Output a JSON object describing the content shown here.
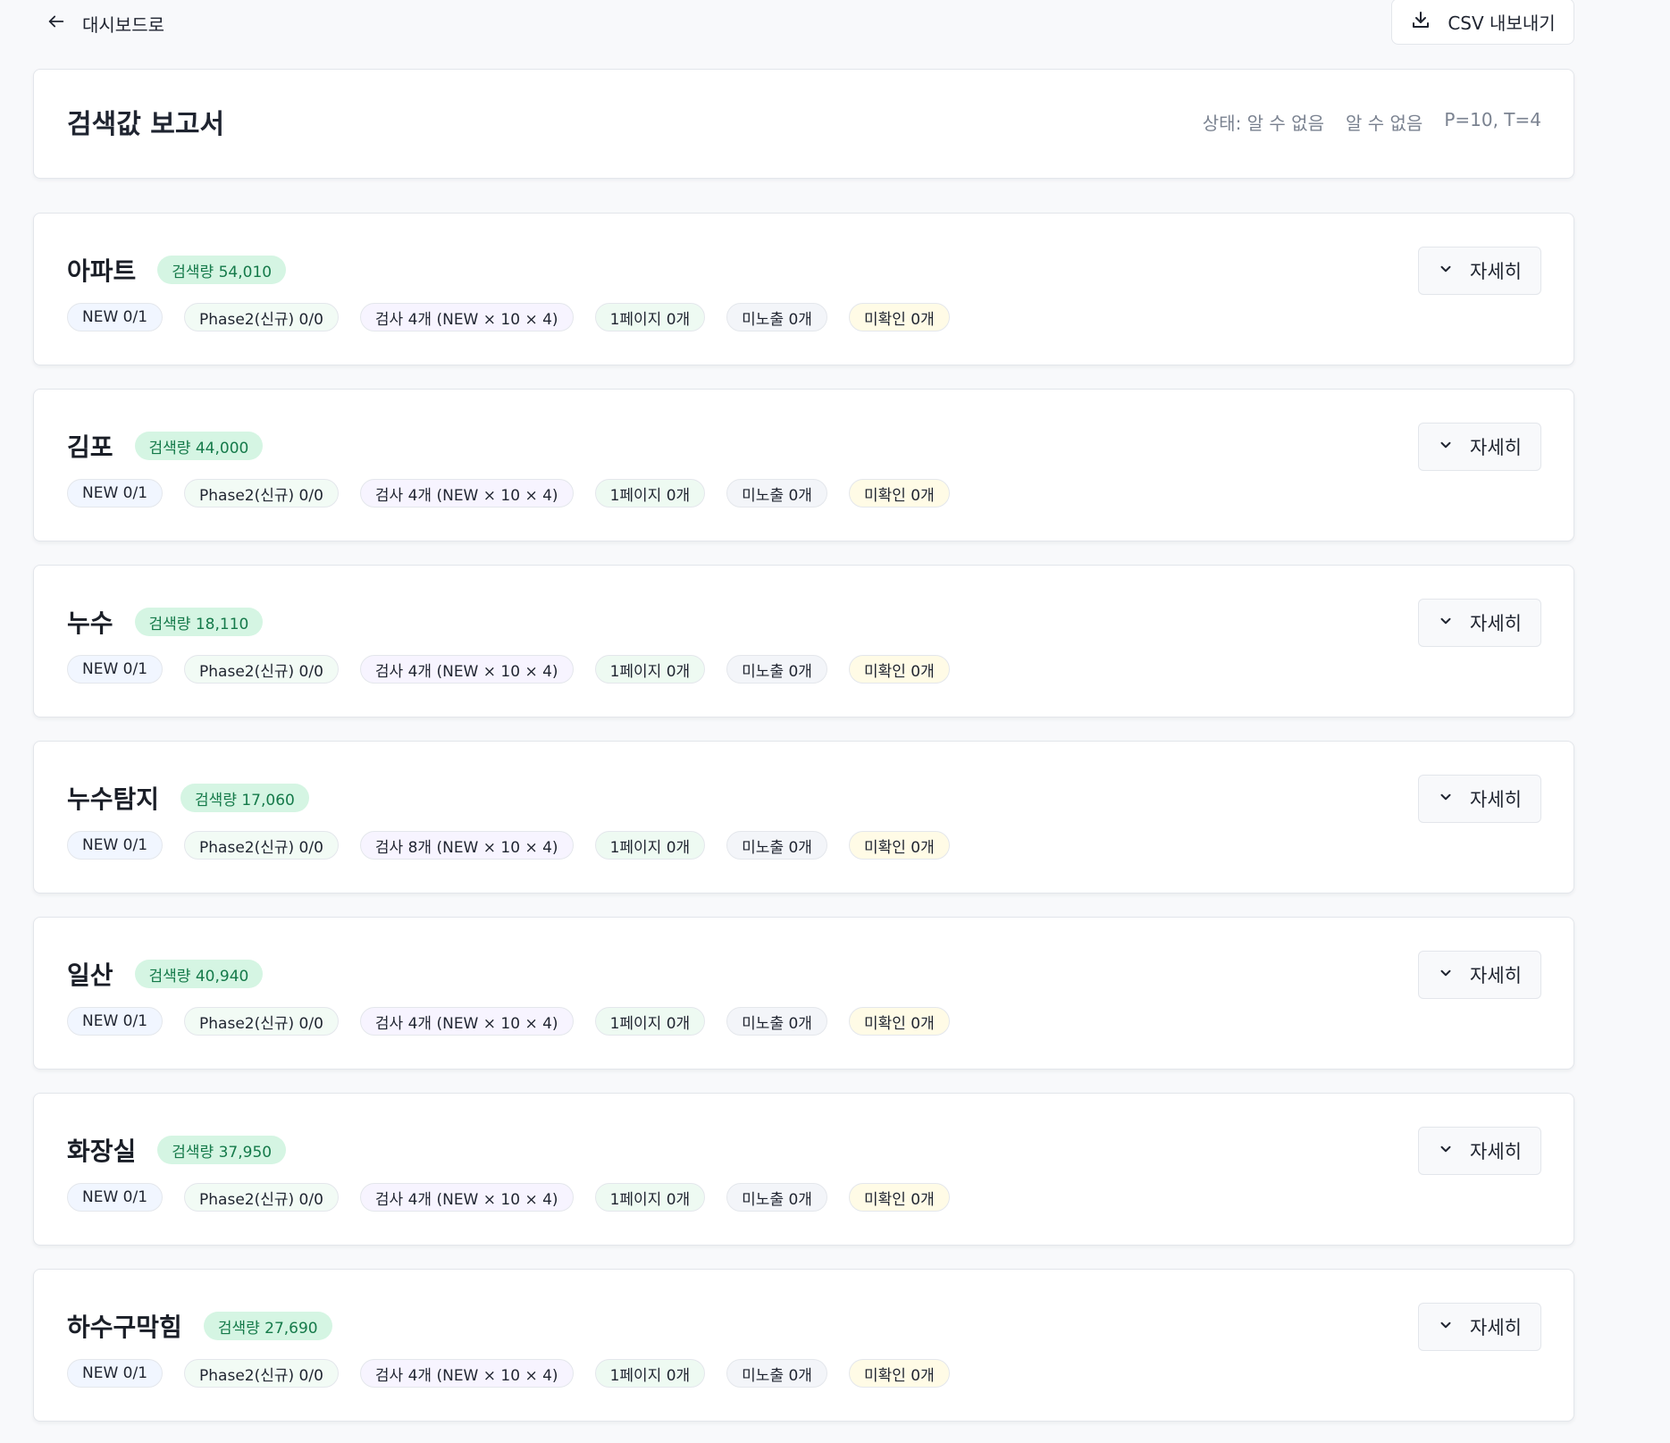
{
  "topbar": {
    "back_label": "대시보드로",
    "export_label": "CSV 내보내기"
  },
  "report": {
    "title": "검색값 보고서",
    "status": "상태: 알 수 없음",
    "status2": "알 수 없음",
    "params": "P=10, T=4"
  },
  "cards": [
    {
      "name": "아파트",
      "volume": "검색량 54,010",
      "chips": [
        "NEW 0/1",
        "Phase2(신규) 0/0",
        "검사 4개 (NEW × 10 × 4)",
        "1페이지 0개",
        "미노출 0개",
        "미확인 0개"
      ],
      "detail_label": "자세히"
    },
    {
      "name": "김포",
      "volume": "검색량 44,000",
      "chips": [
        "NEW 0/1",
        "Phase2(신규) 0/0",
        "검사 4개 (NEW × 10 × 4)",
        "1페이지 0개",
        "미노출 0개",
        "미확인 0개"
      ],
      "detail_label": "자세히"
    },
    {
      "name": "누수",
      "volume": "검색량 18,110",
      "chips": [
        "NEW 0/1",
        "Phase2(신규) 0/0",
        "검사 4개 (NEW × 10 × 4)",
        "1페이지 0개",
        "미노출 0개",
        "미확인 0개"
      ],
      "detail_label": "자세히"
    },
    {
      "name": "누수탐지",
      "volume": "검색량 17,060",
      "chips": [
        "NEW 0/1",
        "Phase2(신규) 0/0",
        "검사 8개 (NEW × 10 × 4)",
        "1페이지 0개",
        "미노출 0개",
        "미확인 0개"
      ],
      "detail_label": "자세히"
    },
    {
      "name": "일산",
      "volume": "검색량 40,940",
      "chips": [
        "NEW 0/1",
        "Phase2(신규) 0/0",
        "검사 4개 (NEW × 10 × 4)",
        "1페이지 0개",
        "미노출 0개",
        "미확인 0개"
      ],
      "detail_label": "자세히"
    },
    {
      "name": "화장실",
      "volume": "검색량 37,950",
      "chips": [
        "NEW 0/1",
        "Phase2(신규) 0/0",
        "검사 4개 (NEW × 10 × 4)",
        "1페이지 0개",
        "미노출 0개",
        "미확인 0개"
      ],
      "detail_label": "자세히"
    },
    {
      "name": "하수구막힘",
      "volume": "검색량 27,690",
      "chips": [
        "NEW 0/1",
        "Phase2(신규) 0/0",
        "검사 4개 (NEW × 10 × 4)",
        "1페이지 0개",
        "미노출 0개",
        "미확인 0개"
      ],
      "detail_label": "자세히"
    }
  ]
}
